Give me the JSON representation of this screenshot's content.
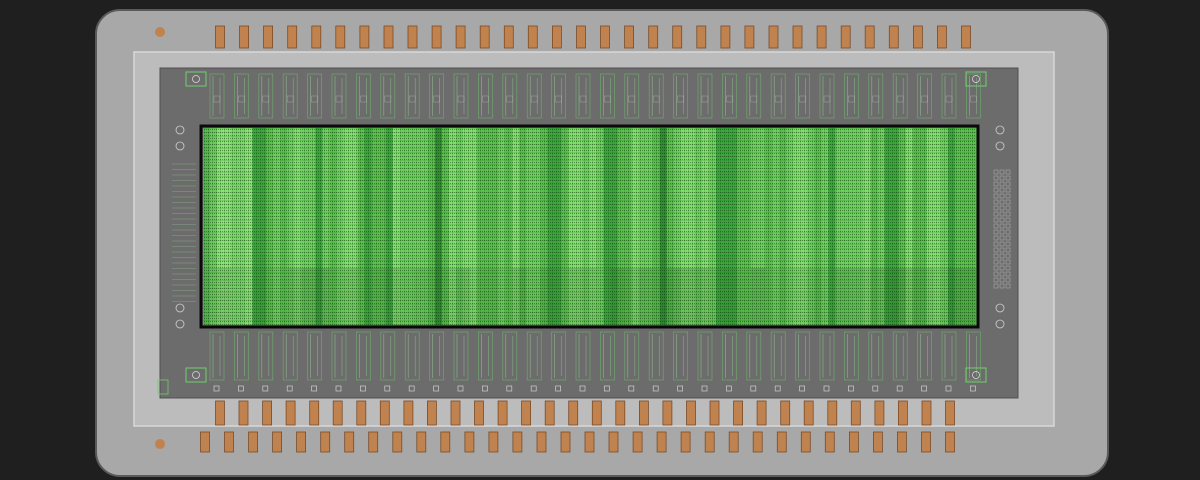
{
  "diagram": {
    "kind": "ic-package-layout",
    "colors": {
      "background": "#1f1f1f",
      "package_fill": "#a8a8a8",
      "package_outline": "#555555",
      "substrate_fill": "#bdbdbd",
      "die_area": "#6c6c6c",
      "pin_fill": "#c0834f",
      "pin_outline": "#7a4b27",
      "core_border": "#0a0a0a",
      "core_green_light": "#7fe06a",
      "core_green_mid": "#3aa83a",
      "core_green_dark": "#1f6e23",
      "circuit_green": "#6fcf6a",
      "fiducial": "#c0834f"
    },
    "pins": {
      "top_row_count": 32,
      "bottom_inner_row_count": 32,
      "bottom_outer_row_count": 32
    },
    "core": {
      "stripe_count": 110,
      "pattern": "dense-green-logic-array"
    }
  }
}
